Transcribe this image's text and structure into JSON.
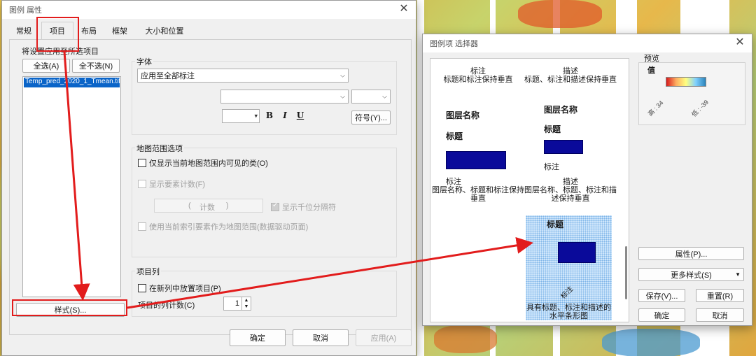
{
  "left_dialog": {
    "title": "图例 属性",
    "tabs": [
      "常规",
      "项目",
      "布局",
      "框架",
      "大小和位置"
    ],
    "apply_label": "将设置应用至所选项目",
    "select_all": "全选(A)",
    "deselect_all": "全不选(N)",
    "list_item": "Temp_pred_2020_1_Tmean.tif",
    "style_button": "样式(S)...",
    "font_group": "字体",
    "font_apply_value": "应用至全部标注",
    "bold": "B",
    "italic": "I",
    "underline": "U",
    "symbol_button": "符号(Y)...",
    "extent_group": "地图范围选项",
    "only_visible": "仅显示当前地图范围内可见的类(O)",
    "show_count": "显示要素计数(F)",
    "count_paren_open": "(",
    "count_label": "计数",
    "count_paren_close": ")",
    "thousand_sep": "显示千位分隔符",
    "use_index": "使用当前索引要素作为地图范围(数据驱动页面)",
    "column_group": "项目列",
    "new_column": "在新列中放置项目(P)",
    "column_count_label": "项目的列计数(C)",
    "column_count_value": "1",
    "ok": "确定",
    "cancel": "取消",
    "apply": "应用(A)"
  },
  "right_dialog": {
    "title": "图例项 选择器",
    "preview_label": "预览",
    "preview_value_label": "值",
    "preview_high": "高 : 34",
    "preview_low": "低 : -39",
    "gallery": [
      {
        "line1": "标注",
        "line2": "标题和标注保持垂直"
      },
      {
        "line1": "描述",
        "line2": "标题、标注和描述保持垂直"
      },
      {
        "layer": "图层名称",
        "title": "标题"
      },
      {
        "layer": "图层名称",
        "title": "标题",
        "label": "标注"
      },
      {
        "line1": "标注",
        "line2": "图层名称、标题和标注保持垂直"
      },
      {
        "line1": "描述",
        "line2": "图层名称、标题、标注和描述保持垂直"
      },
      {
        "title": "标题",
        "side": "标注",
        "desc": "具有标题、标注和描述的水平条形图"
      }
    ],
    "properties_button": "属性(P)...",
    "more_styles": "更多样式(S)",
    "save_button": "保存(V)...",
    "reset_button": "重置(R)",
    "ok": "确定",
    "cancel": "取消"
  },
  "colors": {
    "annotation_red": "#e21c1c",
    "legend_patch": "#0a0a9a"
  }
}
